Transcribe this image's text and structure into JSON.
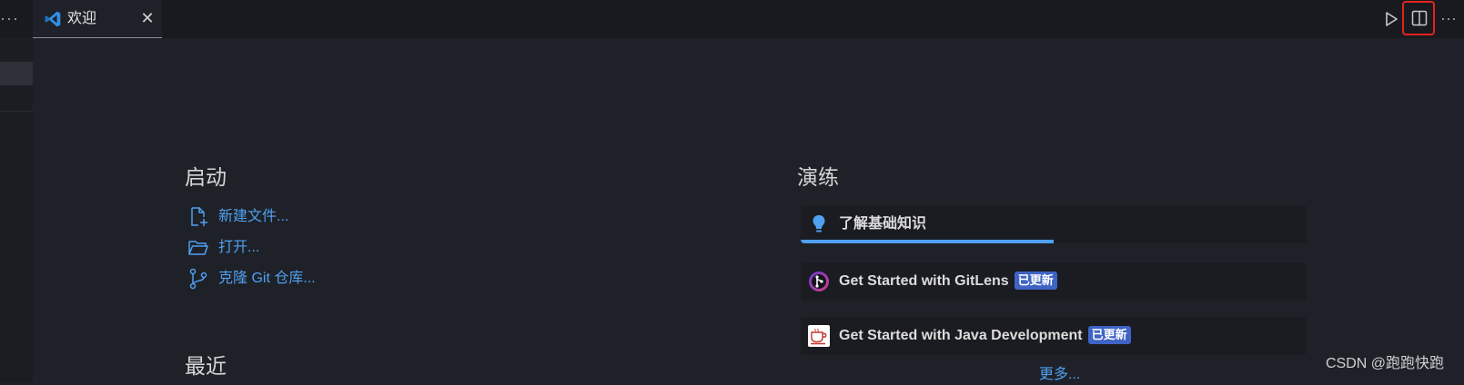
{
  "tabs": {
    "overflow": "···",
    "active": {
      "label": "欢迎",
      "icon": "vscode-logo-icon",
      "close": "✕"
    }
  },
  "toolbar": {
    "run": {
      "icon": "run-triangle-icon"
    },
    "split": {
      "icon": "split-editor-icon",
      "highlight_color": "#e3231b"
    },
    "more": "···"
  },
  "welcome": {
    "start": {
      "title": "启动",
      "items": [
        {
          "label": "新建文件...",
          "icon": "new-file-icon"
        },
        {
          "label": "打开...",
          "icon": "folder-open-icon"
        },
        {
          "label": "克隆 Git 仓库...",
          "icon": "source-control-icon"
        }
      ]
    },
    "recent": {
      "title": "最近"
    },
    "walkthroughs": {
      "title": "演练",
      "items": [
        {
          "label": "了解基础知识",
          "icon": "lightbulb-icon",
          "progress": 0.5
        },
        {
          "label": "Get Started with GitLens",
          "icon": "gitlens-icon",
          "badge": "已更新"
        },
        {
          "label": "Get Started with Java Development",
          "icon": "java-coffee-icon",
          "badge": "已更新"
        }
      ],
      "more": "更多..."
    }
  },
  "colors": {
    "accent": "#4fa0f0",
    "badge": "#3f64c6",
    "background": "#1f2128"
  },
  "watermark": "CSDN @跑跑快跑"
}
